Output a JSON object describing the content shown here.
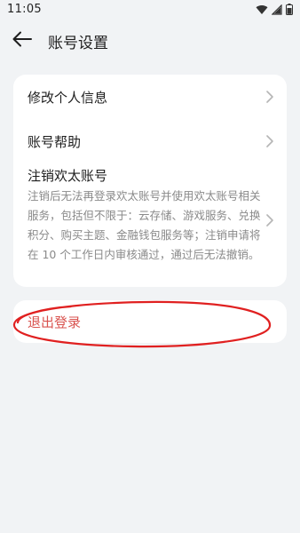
{
  "status": {
    "time": "11:05",
    "icons": [
      "wifi-icon",
      "cellular-signal-icon",
      "battery-icon"
    ]
  },
  "header": {
    "title": "账号设置",
    "back_icon": "arrow-left-icon"
  },
  "settings": {
    "items": [
      {
        "label": "修改个人信息",
        "icon": "chevron-right-icon"
      },
      {
        "label": "账号帮助",
        "icon": "chevron-right-icon"
      },
      {
        "label": "注销欢太账号",
        "description": "注销后无法再登录欢太账号并使用欢太账号相关服务，包括但不限于：云存储、游戏服务、兑换积分、购买主题、金融钱包服务等；注销申请将在 10 个工作日内审核通过，通过后无法撤销。",
        "icon": "chevron-right-icon"
      }
    ]
  },
  "logout": {
    "label": "退出登录"
  },
  "colors": {
    "background": "#f1f3f5",
    "card": "#ffffff",
    "logout_text": "#d9534f",
    "annotation": "#e02020",
    "secondary_text": "#8a8a8a"
  }
}
